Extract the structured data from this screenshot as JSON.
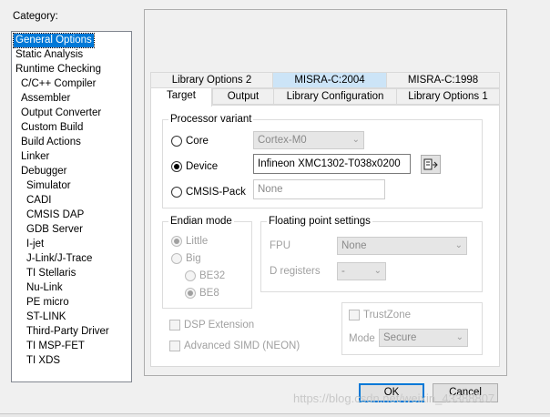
{
  "category": {
    "label": "Category:",
    "selected": "General Options",
    "items": [
      "General Options",
      "Static Analysis",
      "Runtime Checking",
      "C/C++ Compiler",
      "Assembler",
      "Output Converter",
      "Custom Build",
      "Build Actions",
      "Linker",
      "Debugger",
      "Simulator",
      "CADI",
      "CMSIS DAP",
      "GDB Server",
      "I-jet",
      "J-Link/J-Trace",
      "TI Stellaris",
      "Nu-Link",
      "PE micro",
      "ST-LINK",
      "Third-Party Driver",
      "TI MSP-FET",
      "TI XDS"
    ]
  },
  "tabs": {
    "top_row": [
      "Library Options 2",
      "MISRA-C:2004",
      "MISRA-C:1998"
    ],
    "bottom_row": [
      "Target",
      "Output",
      "Library Configuration",
      "Library Options 1"
    ],
    "active": "Target",
    "highlighted_top": "MISRA-C:2004"
  },
  "processor": {
    "title": "Processor variant",
    "core_label": "Core",
    "core_value": "Cortex-M0",
    "device_label": "Device",
    "device_value": "Infineon XMC1302-T038x0200",
    "cmsis_label": "CMSIS-Pack",
    "cmsis_value": "None",
    "selected": "Device"
  },
  "endian": {
    "title": "Endian mode",
    "little": "Little",
    "big": "Big",
    "be32": "BE32",
    "be8": "BE8"
  },
  "float": {
    "title": "Floating point settings",
    "fpu_label": "FPU",
    "fpu_value": "None",
    "dreg_label": "D registers",
    "dreg_value": "-"
  },
  "extensions": {
    "dsp": "DSP Extension",
    "simd": "Advanced SIMD (NEON)"
  },
  "trustzone": {
    "label": "TrustZone",
    "mode_label": "Mode",
    "mode_value": "Secure"
  },
  "buttons": {
    "ok": "OK",
    "cancel": "Cancel"
  },
  "watermark": "https://blog.csdn.net/weixin_43388807"
}
